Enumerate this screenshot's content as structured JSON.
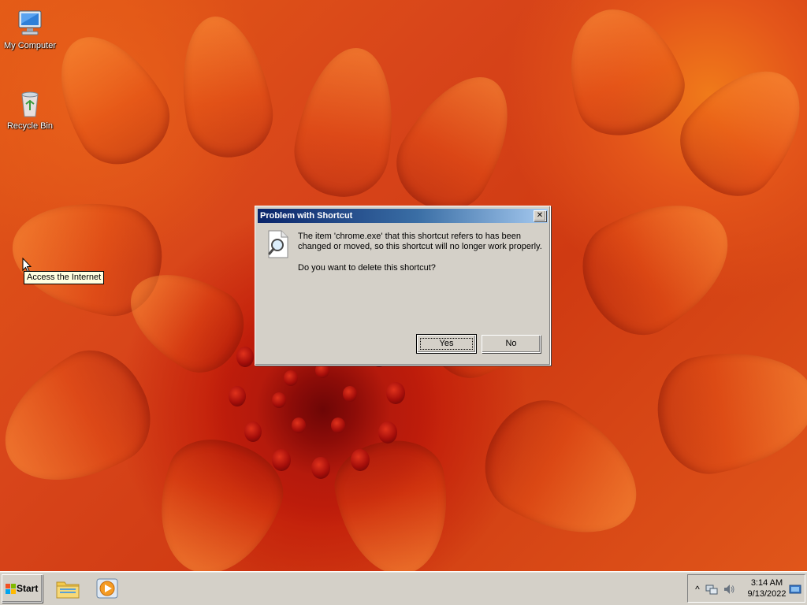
{
  "desktop": {
    "icons": [
      {
        "label": "My Computer",
        "icon": "computer-icon"
      },
      {
        "label": "Recycle Bin",
        "icon": "recycle-bin-icon"
      }
    ],
    "tooltip": "Access the Internet"
  },
  "dialog": {
    "title": "Problem with Shortcut",
    "close_label": "✕",
    "message": "The item 'chrome.exe' that this shortcut refers to has been changed or moved, so this shortcut will no longer work properly.",
    "question": "Do you want to delete this shortcut?",
    "icon": "search-document-icon",
    "buttons": {
      "yes": "Yes",
      "no": "No"
    }
  },
  "taskbar": {
    "start_label": "Start",
    "quick_launch": [
      {
        "icon": "file-explorer-icon"
      },
      {
        "icon": "media-player-icon"
      }
    ],
    "tray": {
      "expand_glyph": "^",
      "icons": [
        "network-icon",
        "volume-icon",
        "show-desktop-icon"
      ],
      "time": "3:14 AM",
      "date": "9/13/2022"
    }
  },
  "colors": {
    "dialog_face": "#d4d0c8",
    "title_bar_start": "#0a246a",
    "title_bar_end": "#a6caf0",
    "tooltip_bg": "#ffffe1"
  }
}
